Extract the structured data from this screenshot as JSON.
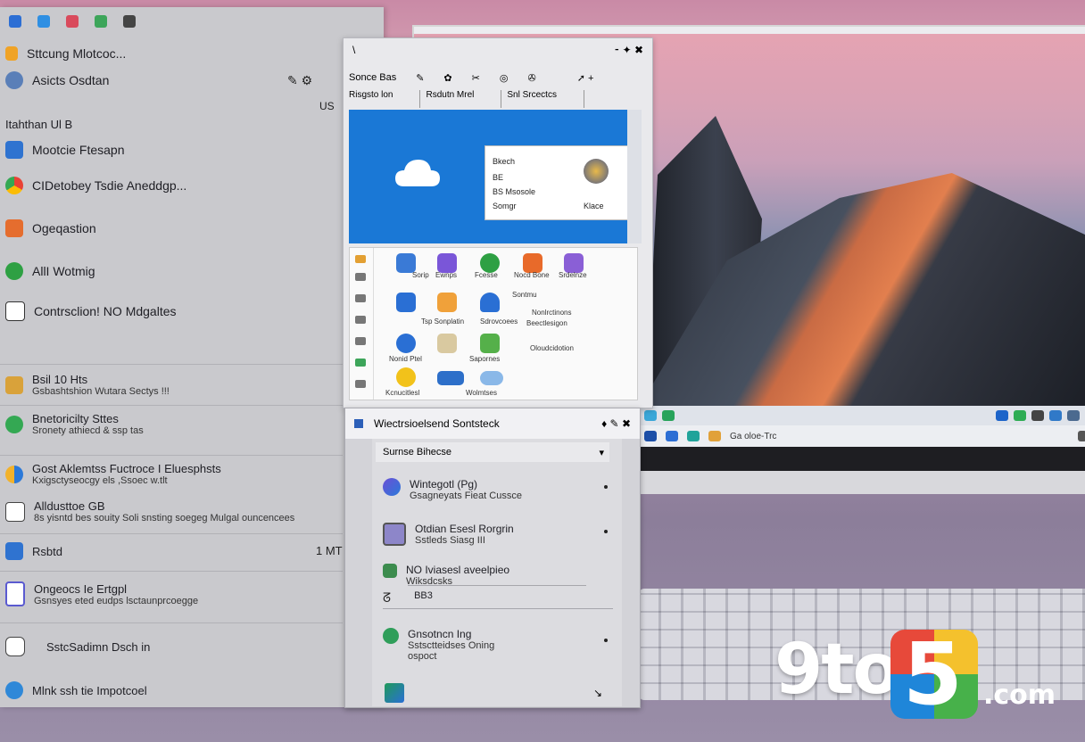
{
  "left_panel": {
    "top_icons": [
      "app-icon-1",
      "app-icon-2",
      "app-icon-3",
      "app-icon-4",
      "app-icon-5"
    ],
    "items": [
      {
        "label": "Sttcung Mlotcoc..."
      },
      {
        "label": "Asicts Osdtan"
      },
      {
        "label": "Itahthan Ul B"
      },
      {
        "label": "Mootcie Ftesapn"
      },
      {
        "label": "CIDetobey Tsdie Aneddgp..."
      },
      {
        "label": "Ogeqastion"
      },
      {
        "label": "AllI Wotmig"
      },
      {
        "label": "Contrsclion! NO Mdgaltes"
      }
    ],
    "right_marks": [
      "US"
    ],
    "sections": [
      {
        "t1": "Bsil 10 Hts",
        "t2": "Gsbashtshion  Wutara Sectys !!!"
      },
      {
        "t1": "Bnetoricilty Sttes",
        "t2": "Sronety athiecd & ssp tas"
      },
      {
        "t1": "Gost Aklemtss Fuctroce I Eluesphsts",
        "t2": "Kxigsctyseocgy els ,Ssoec w.tlt"
      },
      {
        "t1": "Alldusttoe GB",
        "t2": "8s yisntd bes souity Soli snsting soegeg Mulgal ouncencees"
      },
      {
        "t1": "Rsbtd",
        "t2": "",
        "mark": "1 MT"
      },
      {
        "t1": "Ongeocs Ie Ertgpl",
        "t2": "Gsnsyes eted eudps lsctaunprcoegge"
      },
      {
        "t1": "SstcSadimn Dsch in",
        "t2": ""
      },
      {
        "t1": "Mlnk ssh tie Impotcoel",
        "t2": ""
      }
    ]
  },
  "mid_window": {
    "title_left": "\\",
    "title_right": "~",
    "toolbar_label": "Sonce Bas",
    "tabs": [
      "Risgsto lon",
      "Rsdutn Mrel",
      "Snl Srcectcs"
    ],
    "popup_lines": [
      "Bkech",
      "BE",
      "BS Msosole",
      "Somgr",
      "Klace"
    ],
    "grid_labels": [
      "Sorip",
      "Ewnps",
      "Fcesse",
      "Nocd Bone",
      "Srdelnze",
      "Sontmu",
      "Tsp Sonplatin",
      "Sdrovcoees",
      "Nonlrctinons",
      "Beectlesigon",
      "Oloudcidotion",
      "Nonid Ptel",
      "Sapornes",
      "Kcnucitlesl",
      "Wolmtses"
    ]
  },
  "bottom_window": {
    "title": "Wiectrsioelsend Sontsteck",
    "subheader": "Surnse Bihecse",
    "rows": [
      {
        "t1": "Wintegotl (Pg)",
        "t2": "Gsagneyats Fieat Cussce"
      },
      {
        "t1": "Otdian Esesl Rorgrin",
        "t2": "Sstleds Siasg III"
      },
      {
        "t1": "NO Iviasesl aveelpieo",
        "t2": "Wiksdcsks"
      },
      {
        "t1": "BB3",
        "t2": ""
      },
      {
        "t1": "Gnsotncn Ing",
        "t2": "Sstsctteidses Oning",
        "t3": "ospoct"
      }
    ]
  },
  "laptop": {
    "taskbar_text": "Ga oloe-Trc"
  },
  "logo": {
    "prefix": "9to",
    "digit": "5",
    "suffix": ".com"
  }
}
